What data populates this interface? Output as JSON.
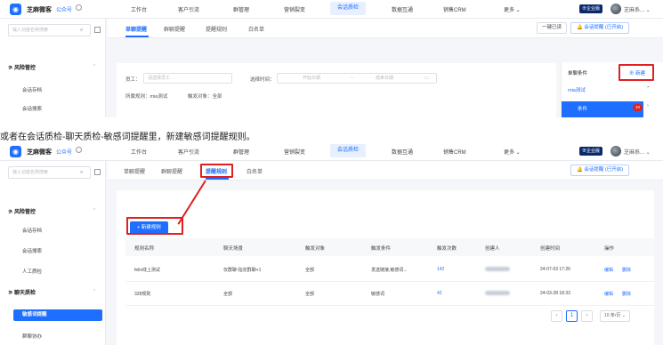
{
  "brand": {
    "name": "芝麻微客",
    "pub": "公众号",
    "accent": "#1e6fff",
    "highlight": "#e02020"
  },
  "nav": [
    "工作台",
    "客户引流",
    "群管理",
    "营销裂变",
    "会话质检",
    "数据互通",
    "销售CRM",
    "更多 ⌄"
  ],
  "user": {
    "badge": "⊕企业版",
    "name": "芝麻系... ⌄"
  },
  "sidebar": {
    "search_placeholder": "输入功能名称搜索",
    "group_risk": "风险管控",
    "risk_items": [
      "会话存档",
      "会话搜索",
      "人工质检"
    ],
    "group_chat": "聊天质检",
    "chat_items": [
      "敏感词提醒",
      "群聊协办"
    ]
  },
  "shot1": {
    "tabs": [
      "单聊提醒",
      "群聊提醒",
      "提醒规则",
      "白名单"
    ],
    "btn_left": "一键已读",
    "btn_right": "会话提醒 (已开启)",
    "form": {
      "staff_label": "员工：",
      "staff_placeholder": "请选择员工",
      "time_label": "选择时间：",
      "start": "开始日期",
      "tilde": "~",
      "end": "结束日期",
      "rule_text": "所属规则：mia测试",
      "target_text": "触发对象：全部"
    },
    "panel": {
      "title": "单聊条件",
      "add": "新建",
      "item": "mia测试",
      "sub": "条件",
      "count": "10"
    }
  },
  "caption": "或者在会话质检-聊天质检-敏感词提醒里，新建敏感词提醒规则。",
  "shot2": {
    "tabs": [
      "单聊提醒",
      "群聊提醒",
      "提醒规则",
      "白名单"
    ],
    "btn_right": "会话提醒 (已开启)",
    "new_rule": "+ 新建规则",
    "headers": [
      "规则名称",
      "聊天场景",
      "触发对象",
      "触发条件",
      "触发次数",
      "创建人",
      "创建时间",
      "操作"
    ],
    "rows": [
      {
        "name": "felix线上测试",
        "scene": "仅群聊-指定群聊+1",
        "target": "全部",
        "cond": "发送链接,敏感词...",
        "count": "142",
        "time": "24-07-03 17:26",
        "edit": "编辑",
        "del": "删除"
      },
      {
        "name": "328规则",
        "scene": "全部",
        "target": "全部",
        "cond": "敏感词",
        "count": "42",
        "time": "24-03-28 18:33",
        "edit": "编辑",
        "del": "删除"
      }
    ],
    "pager": {
      "prev": "‹",
      "page": "1",
      "next": "›",
      "size": "10 条/页 ⌄"
    }
  }
}
